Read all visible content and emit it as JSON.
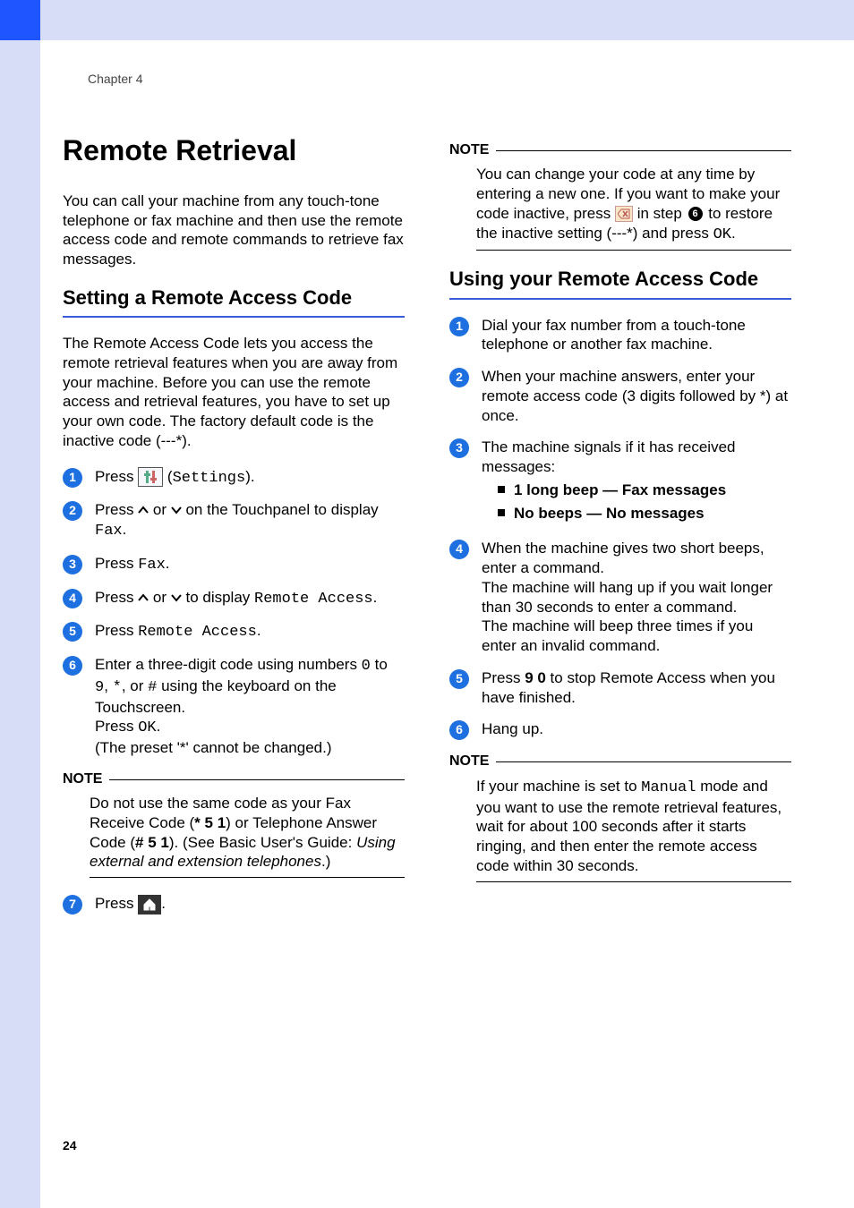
{
  "chapter": "Chapter 4",
  "page_number": "24",
  "h1": "Remote Retrieval",
  "intro": "You can call your machine from any touch-tone telephone or fax machine and then use the remote access code and remote commands to retrieve fax messages.",
  "left": {
    "h2": "Setting a Remote Access Code",
    "para": "The Remote Access Code lets you access the remote retrieval features when you are away from your machine. Before you can use the remote access and retrieval features, you have to set up your own code. The factory default code is the inactive code (---*).",
    "steps": {
      "s1a": "Press ",
      "s1b": " (",
      "s1c": "Settings",
      "s1d": ").",
      "s2a": "Press ",
      "s2b": " or ",
      "s2c": " on the Touchpanel to display ",
      "s2d": "Fax",
      "s2e": ".",
      "s3a": "Press ",
      "s3b": "Fax",
      "s3c": ".",
      "s4a": "Press ",
      "s4b": " or ",
      "s4c": " to display ",
      "s4d": "Remote Access",
      "s4e": ".",
      "s5a": "Press ",
      "s5b": "Remote Access",
      "s5c": ".",
      "s6a": "Enter a three-digit code using numbers ",
      "s6b": "0",
      "s6c": " to ",
      "s6d": "9",
      "s6e": ", ",
      "s6f": "*",
      "s6g": ", or ",
      "s6h": "#",
      "s6i": " using the keyboard on the Touchscreen.",
      "s6j": "Press ",
      "s6k": "OK",
      "s6l": ".",
      "s6m": "(The preset '*' cannot be changed.)",
      "s7a": "Press ",
      "s7b": "."
    },
    "note1": {
      "label": "NOTE",
      "a": "Do not use the same code as your Fax Receive Code (",
      "b": "* 5 1",
      "c": ") or Telephone Answer Code (",
      "d": "# 5 1",
      "e": "). (See Basic User's Guide: ",
      "f": "Using external and extension telephones",
      "g": ".)"
    }
  },
  "right": {
    "note1": {
      "label": "NOTE",
      "a": "You can change your code at any time by entering a new one. If you want to make your code inactive, press ",
      "b": " in step ",
      "c": " to restore the inactive setting (---*) and press ",
      "d": "OK",
      "e": "."
    },
    "h2": "Using your Remote Access Code",
    "steps": {
      "s1": "Dial your fax number from a touch-tone telephone or another fax machine.",
      "s2": "When your machine answers, enter your remote access code (3 digits followed by *) at once.",
      "s3": "The machine signals if it has received messages:",
      "s3b1": "1 long beep — Fax messages",
      "s3b2": "No beeps — No messages",
      "s4a": "When the machine gives two short beeps, enter a command.",
      "s4b": "The machine will hang up if you wait longer than 30 seconds to enter a command.",
      "s4c": "The machine will beep three times if you enter an invalid command.",
      "s5a": "Press ",
      "s5b": "9 0",
      "s5c": " to stop Remote Access when you have finished.",
      "s6": "Hang up."
    },
    "note2": {
      "label": "NOTE",
      "a": "If your machine is set to ",
      "b": "Manual",
      "c": " mode and you want to use the remote retrieval features, wait for about 100 seconds after it starts ringing, and then enter the remote access code within 30 seconds."
    }
  }
}
